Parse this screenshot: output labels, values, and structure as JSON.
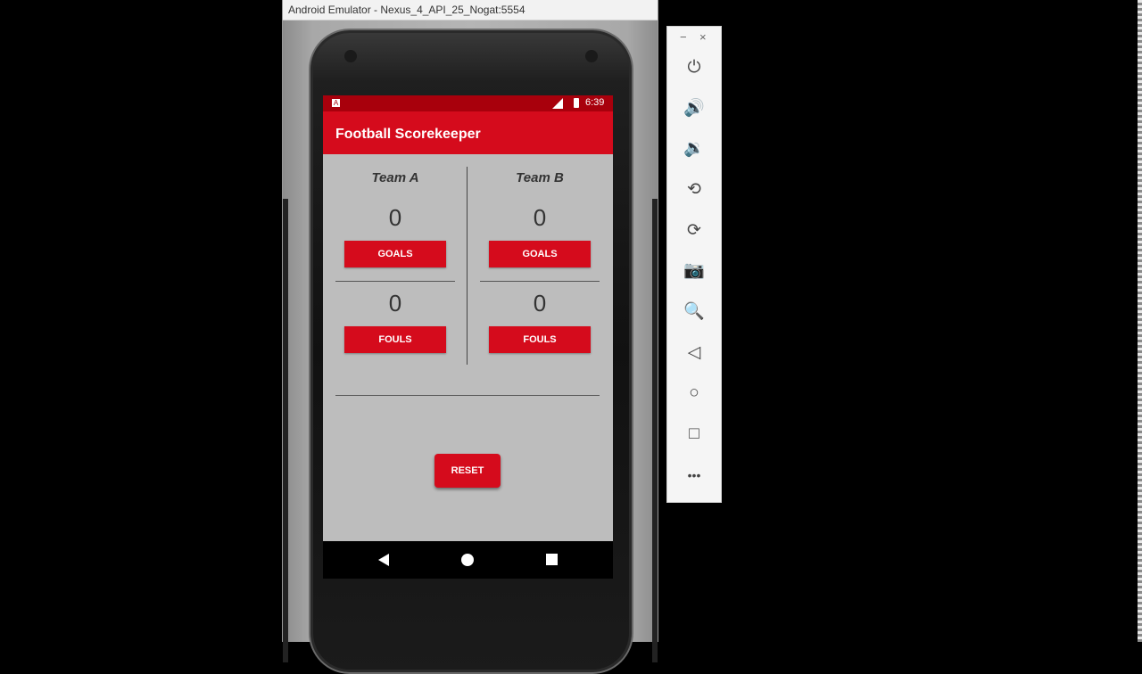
{
  "window": {
    "title": "Android Emulator - Nexus_4_API_25_Nogat:5554"
  },
  "statusbar": {
    "time": "6:39"
  },
  "app": {
    "title": "Football Scorekeeper"
  },
  "team_a": {
    "name": "Team A",
    "goals": "0",
    "goals_button": "GOALS",
    "fouls": "0",
    "fouls_button": "FOULS"
  },
  "team_b": {
    "name": "Team B",
    "goals": "0",
    "goals_button": "GOALS",
    "fouls": "0",
    "fouls_button": "FOULS"
  },
  "reset_button": "RESET",
  "colors": {
    "primary": "#d50b1c",
    "primary_dark": "#a8000c",
    "screen_background": "#bdbdbd"
  },
  "toolbar": {
    "minimize": "−",
    "close": "×",
    "items": [
      {
        "icon": "power-icon",
        "glyph": "⏻"
      },
      {
        "icon": "volume-up-icon",
        "glyph": "🔊"
      },
      {
        "icon": "volume-down-icon",
        "glyph": "🔉"
      },
      {
        "icon": "rotate-left-icon",
        "glyph": "⟲"
      },
      {
        "icon": "rotate-right-icon",
        "glyph": "⟳"
      },
      {
        "icon": "camera-icon",
        "glyph": "📷"
      },
      {
        "icon": "zoom-icon",
        "glyph": "🔍"
      },
      {
        "icon": "back-icon",
        "glyph": "◁"
      },
      {
        "icon": "home-icon",
        "glyph": "○"
      },
      {
        "icon": "overview-icon",
        "glyph": "□"
      },
      {
        "icon": "more-icon",
        "glyph": "•••"
      }
    ]
  }
}
